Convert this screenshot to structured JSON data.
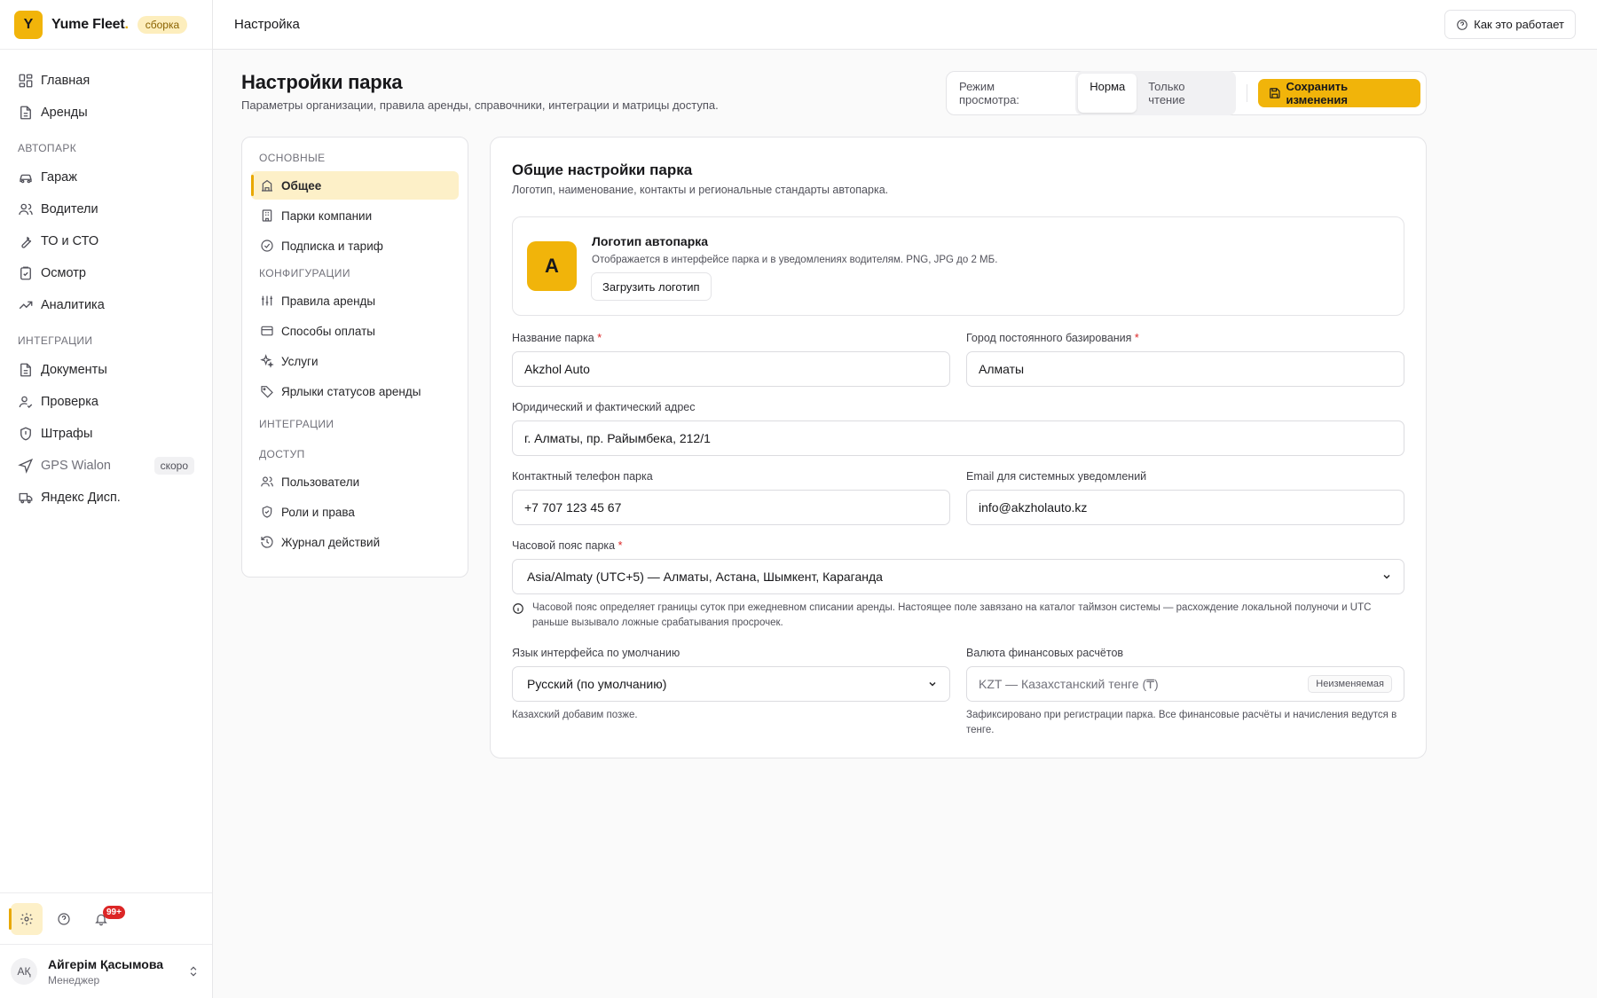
{
  "brand": {
    "logo_letter": "Y",
    "name": "Yume Fleet",
    "dot": ".",
    "badge": "сборка"
  },
  "sidebar": {
    "top_items": [
      {
        "label": "Главная",
        "icon": "dashboard-icon"
      },
      {
        "label": "Аренды",
        "icon": "document-icon"
      }
    ],
    "sections": [
      {
        "title": "АВТОПАРК",
        "items": [
          {
            "label": "Гараж",
            "icon": "car-icon"
          },
          {
            "label": "Водители",
            "icon": "users-icon"
          },
          {
            "label": "ТО и СТО",
            "icon": "wrench-icon"
          },
          {
            "label": "Осмотр",
            "icon": "clipboard-check-icon"
          },
          {
            "label": "Аналитика",
            "icon": "trend-icon"
          }
        ]
      },
      {
        "title": "ИНТЕГРАЦИИ",
        "items": [
          {
            "label": "Документы",
            "icon": "document-icon"
          },
          {
            "label": "Проверка",
            "icon": "user-check-icon"
          },
          {
            "label": "Штрафы",
            "icon": "shield-alert-icon"
          },
          {
            "label": "GPS Wialon",
            "icon": "navigation-icon",
            "tag": "скоро"
          },
          {
            "label": "Яндекс Дисп.",
            "icon": "truck-icon"
          }
        ]
      }
    ],
    "notifications_badge": "99+",
    "user": {
      "initials": "AҚ",
      "name": "Айгерім Қасымова",
      "role": "Менеджер"
    }
  },
  "topbar": {
    "title": "Настройка",
    "help_label": "Как это работает"
  },
  "page": {
    "title": "Настройки парка",
    "subtitle": "Параметры организации, правила аренды, справочники, интеграции и матрицы доступа.",
    "mode_label": "Режим просмотра:",
    "mode_options": [
      "Норма",
      "Только чтение"
    ],
    "mode_selected": "Норма",
    "save_label": "Сохранить изменения"
  },
  "settings_nav": {
    "basic_title": "ОСНОВНЫЕ",
    "basic": [
      "Общее",
      "Парки компании",
      "Подписка и тариф"
    ],
    "config_title": "КОНФИГУРАЦИИ",
    "config": [
      "Правила аренды",
      "Способы оплаты",
      "Услуги",
      "Ярлыки статусов аренды"
    ],
    "integrations_title": "ИНТЕГРАЦИИ",
    "access_title": "ДОСТУП",
    "access": [
      "Пользователи",
      "Роли и права",
      "Журнал действий"
    ]
  },
  "general": {
    "title": "Общие настройки парка",
    "subtitle": "Логотип, наименование, контакты и региональные стандарты автопарка.",
    "logo": {
      "letter": "A",
      "title": "Логотип автопарка",
      "desc": "Отображается в интерфейсе парка и в уведомлениях водителям. PNG, JPG до 2 МБ.",
      "upload_label": "Загрузить логотип"
    },
    "park_name": {
      "label": "Название парка",
      "value": "Akzhol Auto"
    },
    "city": {
      "label": "Город постоянного базирования",
      "value": "Алматы"
    },
    "address": {
      "label": "Юридический и фактический адрес",
      "value": "г. Алматы, пр. Райымбека, 212/1"
    },
    "phone": {
      "label": "Контактный телефон парка",
      "value": "+7 707 123 45 67"
    },
    "email": {
      "label": "Email для системных уведомлений",
      "value": "info@akzholauto.kz"
    },
    "timezone": {
      "label": "Часовой пояс парка",
      "value": "Asia/Almaty (UTC+5) — Алматы, Астана, Шымкент, Караганда",
      "hint": "Часовой пояс определяет границы суток при ежедневном списании аренды. Настоящее поле завязано на каталог таймзон системы — расхождение локальной полуночи и UTC раньше вызывало ложные срабатывания просрочек."
    },
    "language": {
      "label": "Язык интерфейса по умолчанию",
      "value": "Русский (по умолчанию)",
      "hint": "Казахский добавим позже."
    },
    "currency": {
      "label": "Валюта финансовых расчётов",
      "value": "KZT — Казахстанский тенге (₸)",
      "tag": "Неизменяемая",
      "hint": "Зафиксировано при регистрации парка. Все финансовые расчёты и начисления ведутся в тенге."
    }
  },
  "colors": {
    "accent": "#f1b40a",
    "accent_soft": "#fdf0c8",
    "danger": "#dc2626"
  }
}
